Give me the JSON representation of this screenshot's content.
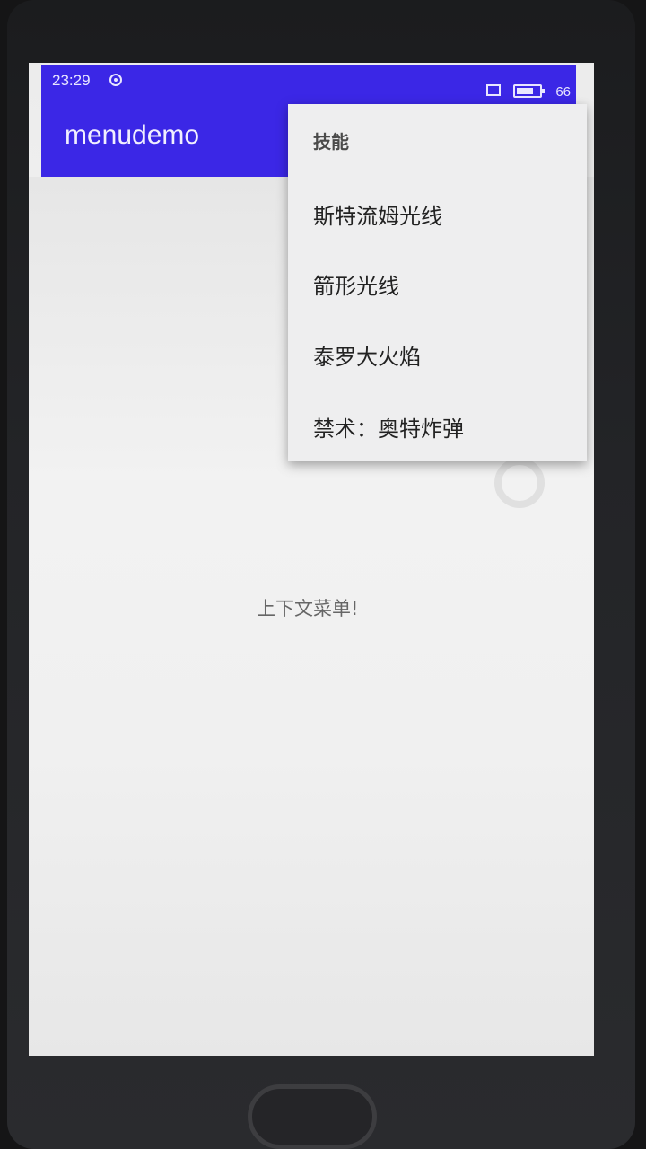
{
  "status_bar": {
    "time": "23:29",
    "battery": "66",
    "icons": [
      "sync-icon",
      "notification-rect-icon",
      "battery-icon"
    ]
  },
  "app_bar": {
    "title": "menudemo",
    "background": "#3b27e6"
  },
  "main": {
    "center_text": "上下文菜单!"
  },
  "popup_menu": {
    "header": "技能",
    "items": [
      {
        "label": "斯特流姆光线"
      },
      {
        "label": "箭形光线"
      },
      {
        "label": "泰罗大火焰"
      },
      {
        "label": "禁术：奥特炸弹"
      }
    ]
  }
}
